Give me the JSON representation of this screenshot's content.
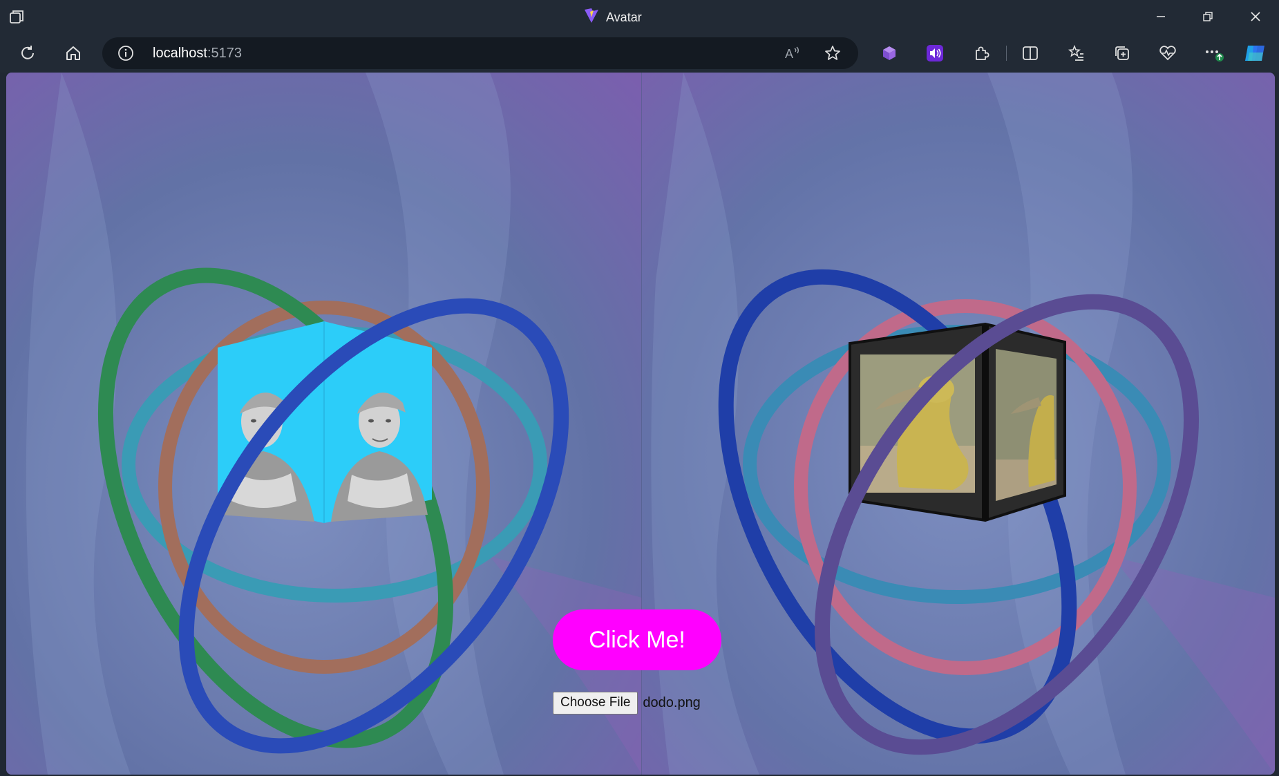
{
  "window": {
    "title": "Avatar",
    "controls": [
      "minimize",
      "restore",
      "close"
    ]
  },
  "address_bar": {
    "host": "localhost",
    "port": ":5173"
  },
  "page": {
    "click_button_label": "Click Me!",
    "file_input": {
      "button_label": "Choose File",
      "file_name": "dodo.png"
    }
  },
  "colors": {
    "accent_button": "#ff00ff",
    "left_rings": [
      "#2e8a52",
      "#a26e5c",
      "#3a9bb5",
      "#2a4bb8"
    ],
    "right_rings": [
      "#c06a8a",
      "#5a4c93",
      "#3a8bb5",
      "#1f3ea8"
    ],
    "left_cube_color": "#2ccdf9"
  }
}
